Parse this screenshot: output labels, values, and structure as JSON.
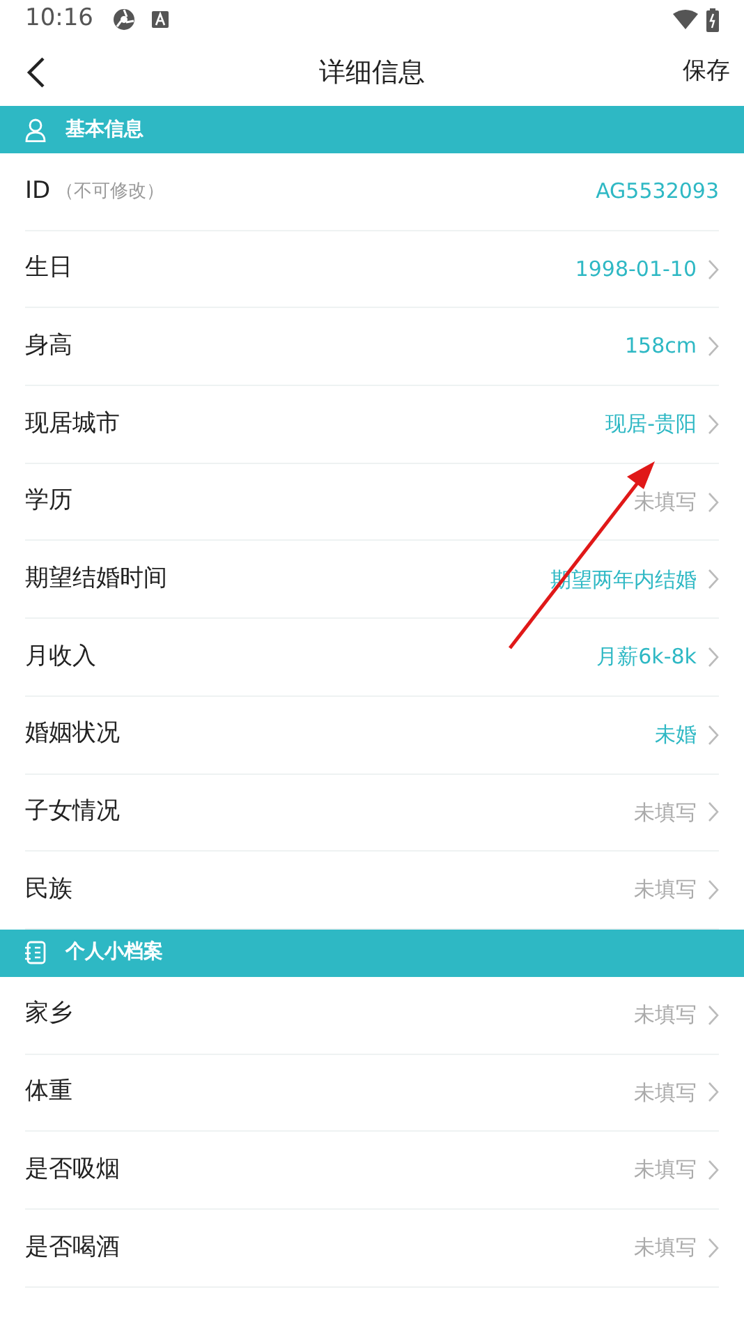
{
  "status_bar": {
    "time": "10:16"
  },
  "header": {
    "title": "详细信息",
    "action": "保存"
  },
  "sections": [
    {
      "title": "基本信息",
      "rows": [
        {
          "label": "ID",
          "note": "（不可修改）",
          "value": "AG5532093",
          "filled": true,
          "chevron": false
        },
        {
          "label": "生日",
          "value": "1998-01-10",
          "filled": true,
          "chevron": true
        },
        {
          "label": "身高",
          "value": "158cm",
          "filled": true,
          "chevron": true
        },
        {
          "label": "现居城市",
          "value": "现居-贵阳",
          "filled": true,
          "chevron": true
        },
        {
          "label": "学历",
          "value": "未填写",
          "filled": false,
          "chevron": true
        },
        {
          "label": "期望结婚时间",
          "value": "期望两年内结婚",
          "filled": true,
          "chevron": true
        },
        {
          "label": "月收入",
          "value": "月薪6k-8k",
          "filled": true,
          "chevron": true
        },
        {
          "label": "婚姻状况",
          "value": "未婚",
          "filled": true,
          "chevron": true
        },
        {
          "label": "子女情况",
          "value": "未填写",
          "filled": false,
          "chevron": true
        },
        {
          "label": "民族",
          "value": "未填写",
          "filled": false,
          "chevron": true
        }
      ]
    },
    {
      "title": "个人小档案",
      "rows": [
        {
          "label": "家乡",
          "value": "未填写",
          "filled": false,
          "chevron": true
        },
        {
          "label": "体重",
          "value": "未填写",
          "filled": false,
          "chevron": true
        },
        {
          "label": "是否吸烟",
          "value": "未填写",
          "filled": false,
          "chevron": true
        },
        {
          "label": "是否喝酒",
          "value": "未填写",
          "filled": false,
          "chevron": true
        }
      ]
    }
  ],
  "annotation": {
    "kind": "arrow"
  }
}
